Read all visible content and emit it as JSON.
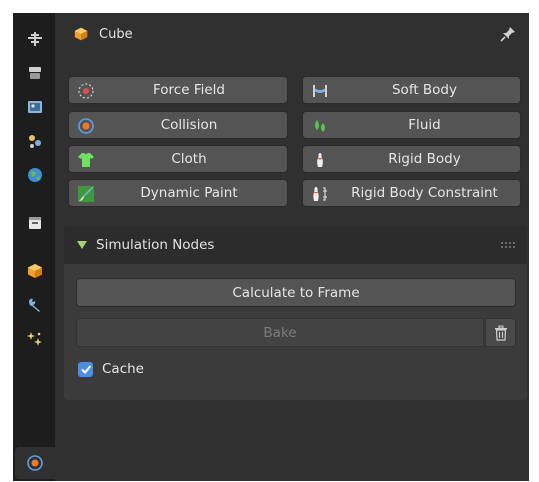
{
  "header": {
    "object_name": "Cube"
  },
  "physics_buttons": {
    "force_field": "Force Field",
    "soft_body": "Soft Body",
    "collision": "Collision",
    "fluid": "Fluid",
    "cloth": "Cloth",
    "rigid_body": "Rigid Body",
    "dynamic_paint": "Dynamic Paint",
    "rigid_body_constraint": "Rigid Body Constraint"
  },
  "simulation_panel": {
    "title": "Simulation Nodes",
    "calculate_label": "Calculate to Frame",
    "bake_label": "Bake",
    "cache_label": "Cache",
    "cache_checked": true
  },
  "tabs": [
    {
      "name": "tool-tab",
      "icon": "tool-icon"
    },
    {
      "name": "render-tab",
      "icon": "render-icon"
    },
    {
      "name": "output-tab",
      "icon": "output-icon"
    },
    {
      "name": "view-layer-tab",
      "icon": "view-layer-icon"
    },
    {
      "name": "world-tab",
      "icon": "world-icon"
    },
    {
      "name": "collection-tab",
      "icon": "collection-icon"
    },
    {
      "name": "object-tab",
      "icon": "object-icon"
    },
    {
      "name": "modifiers-tab",
      "icon": "wrench-icon"
    },
    {
      "name": "particles-tab",
      "icon": "particles-icon"
    },
    {
      "name": "physics-tab",
      "icon": "physics-icon",
      "active": true
    }
  ],
  "colors": {
    "background": "#303030",
    "button": "#545454",
    "accent_check": "#4a8fe0",
    "panel_triangle": "#a6d66b"
  }
}
